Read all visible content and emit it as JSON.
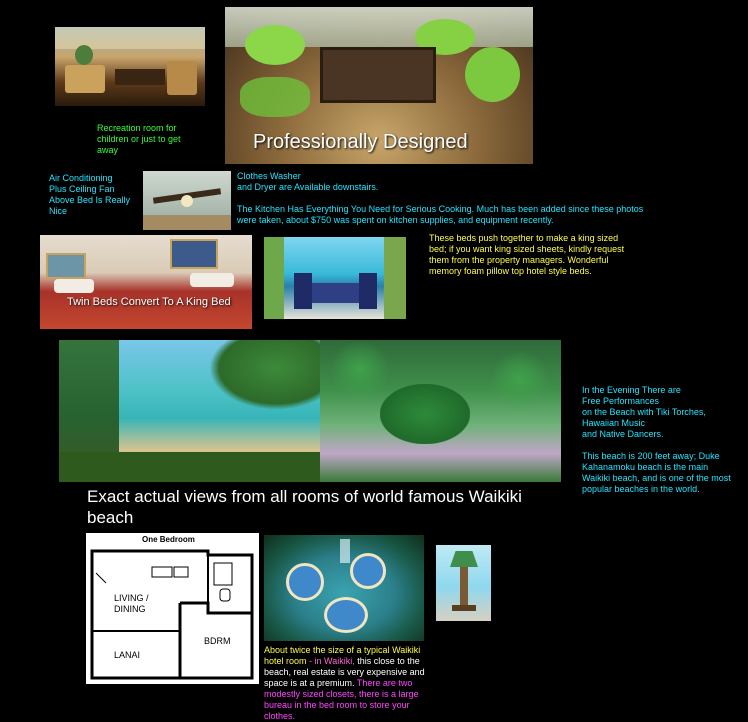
{
  "photos": {
    "patio_overlay": "Professionally Designed",
    "beds_overlay": "Twin Beds Convert To A King Bed"
  },
  "captions": {
    "recreation": "Recreation room for children or just to get away",
    "aircon_line1": "Air Conditioning",
    "aircon_line2": "Plus Ceiling Fan",
    "aircon_line3": "Above Bed Is Really Nice",
    "washer_line1": "Clothes Washer",
    "washer_line2": "and Dryer are Available downstairs.",
    "kitchen": "The Kitchen Has Everything You Need for Serious Cooking. Much has been added since these photos were taken, about $750 was spent on kitchen supplies, and equipment recently.",
    "beds": "These beds push together to make a king sized bed; if you want king sized sheets, kindly request them from the property managers. Wonderful memory foam pillow top hotel style beds.",
    "evening_line1": "In the Evening There are",
    "evening_line2": "Free Performances",
    "evening_line3": "on the Beach with Tiki Torches,",
    "evening_line4": "Hawaiian Music",
    "evening_line5": "and Native Dancers.",
    "beach": "This beach is 200 feet away; Duke Kahanamoku beach is the main Waikiki beach, and is one of the most popular beaches in the world.",
    "views_heading": "Exact actual views from all rooms of world famous Waikiki beach",
    "size_part1": "About twice the size of a typical Waikiki hotel room",
    "size_part2": " - in Waikiki,",
    "size_part3": " this close to the beach, real estate is very expensive and space is at a premium.",
    "size_part4": " There are two modestly sized closets,  there is a large bureau in the bed room to store your clothes."
  },
  "floorplan": {
    "title": "One Bedroom",
    "living": "LIVING /",
    "dining": "DINING",
    "bdrm": "BDRM",
    "lanai": "LANAI"
  }
}
